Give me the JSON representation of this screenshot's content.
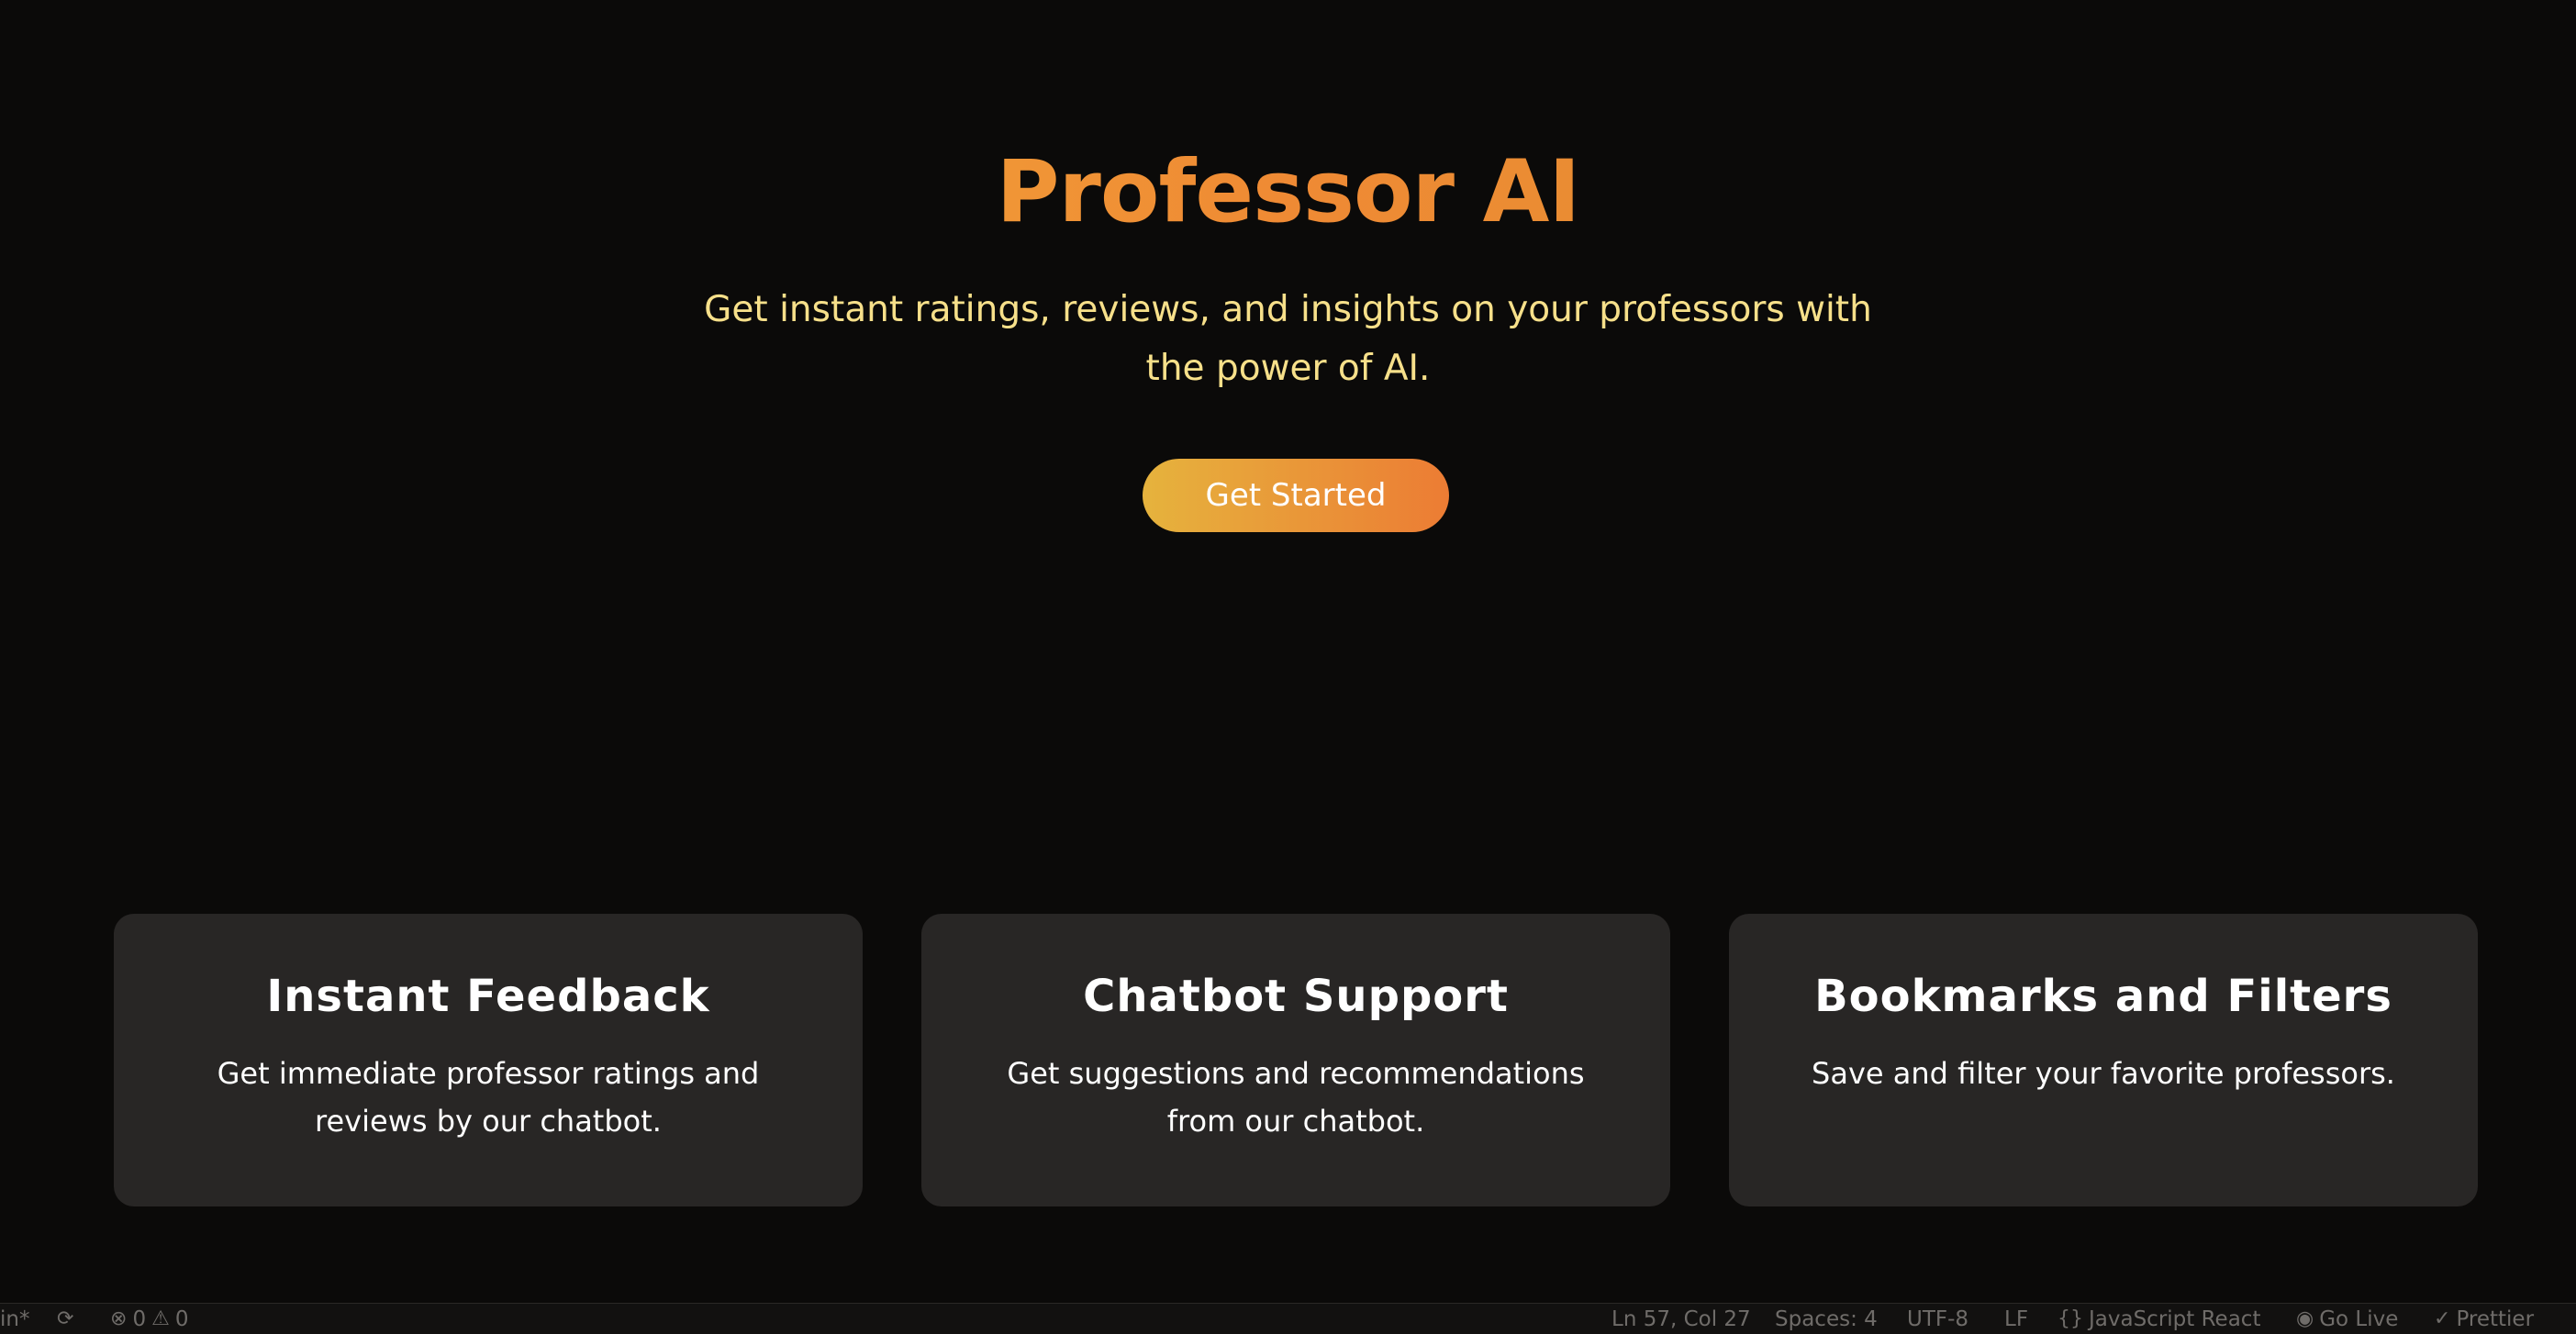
{
  "hero": {
    "title": "Professor AI",
    "subtitle": "Get instant ratings, reviews, and insights on your professors with the power of AI.",
    "cta_label": "Get Started"
  },
  "features": [
    {
      "title": "Instant Feedback",
      "description": "Get immediate professor ratings and reviews by our chatbot."
    },
    {
      "title": "Chatbot Support",
      "description": "Get suggestions and recommendations from our chatbot."
    },
    {
      "title": "Bookmarks and Filters",
      "description": "Save and filter your favorite professors."
    }
  ],
  "statusbar": {
    "branch": "in*",
    "sync_icon": "sync-icon",
    "errors": "0",
    "warnings": "0",
    "cursor_position": "Ln 57, Col 27",
    "indentation": "Spaces: 4",
    "encoding": "UTF-8",
    "line_ending": "LF",
    "language": "JavaScript React",
    "go_live": "Go Live",
    "formatter": "Prettier"
  },
  "colors": {
    "background": "#0b0a09",
    "title_gradient_start": "#f2be3c",
    "title_gradient_mid": "#ef8a34",
    "subtitle": "#f7e08a",
    "button_gradient_start": "#e6b33d",
    "button_gradient_end": "#ec7c34",
    "card_background": "#282625"
  }
}
